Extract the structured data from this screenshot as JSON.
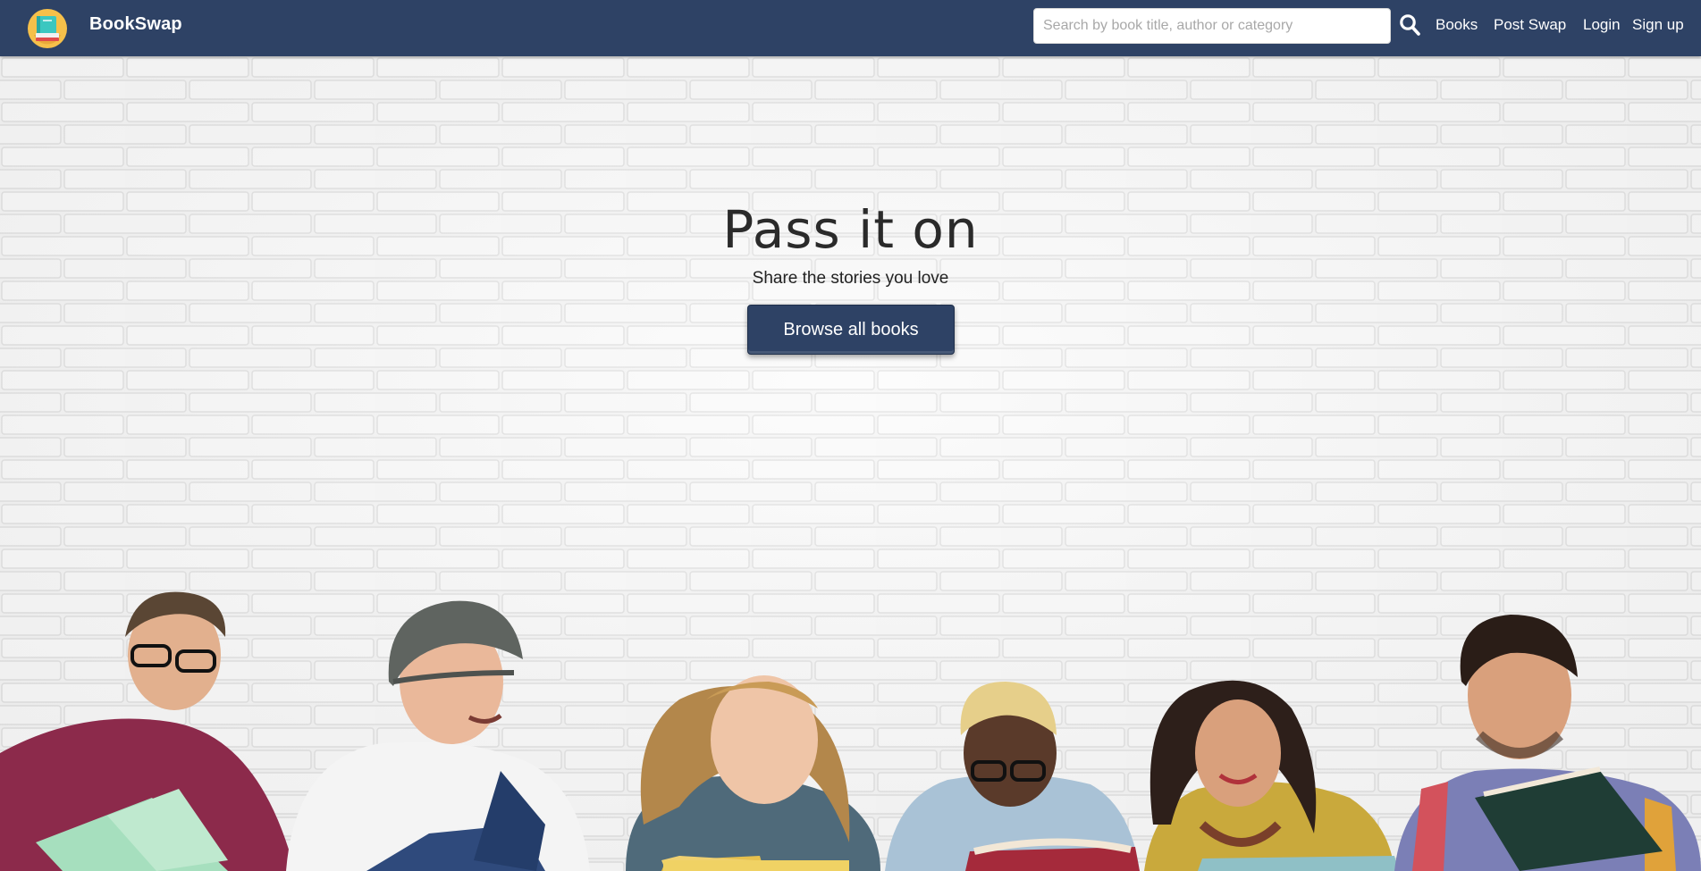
{
  "header": {
    "brand": "BookSwap",
    "search": {
      "placeholder": "Search by book title, author or category",
      "value": ""
    },
    "nav": {
      "books": "Books",
      "post_swap": "Post Swap",
      "login": "Login",
      "signup": "Sign up"
    },
    "icons": {
      "logo": "book-logo-icon",
      "search": "search-icon"
    }
  },
  "hero": {
    "title": "Pass it on",
    "subtitle": "Share the stories you love",
    "cta_label": "Browse all books",
    "background": "white-brick-wall-with-readers"
  },
  "colors": {
    "primary": "#2e4265",
    "white": "#ffffff",
    "text_dark": "#222222"
  }
}
